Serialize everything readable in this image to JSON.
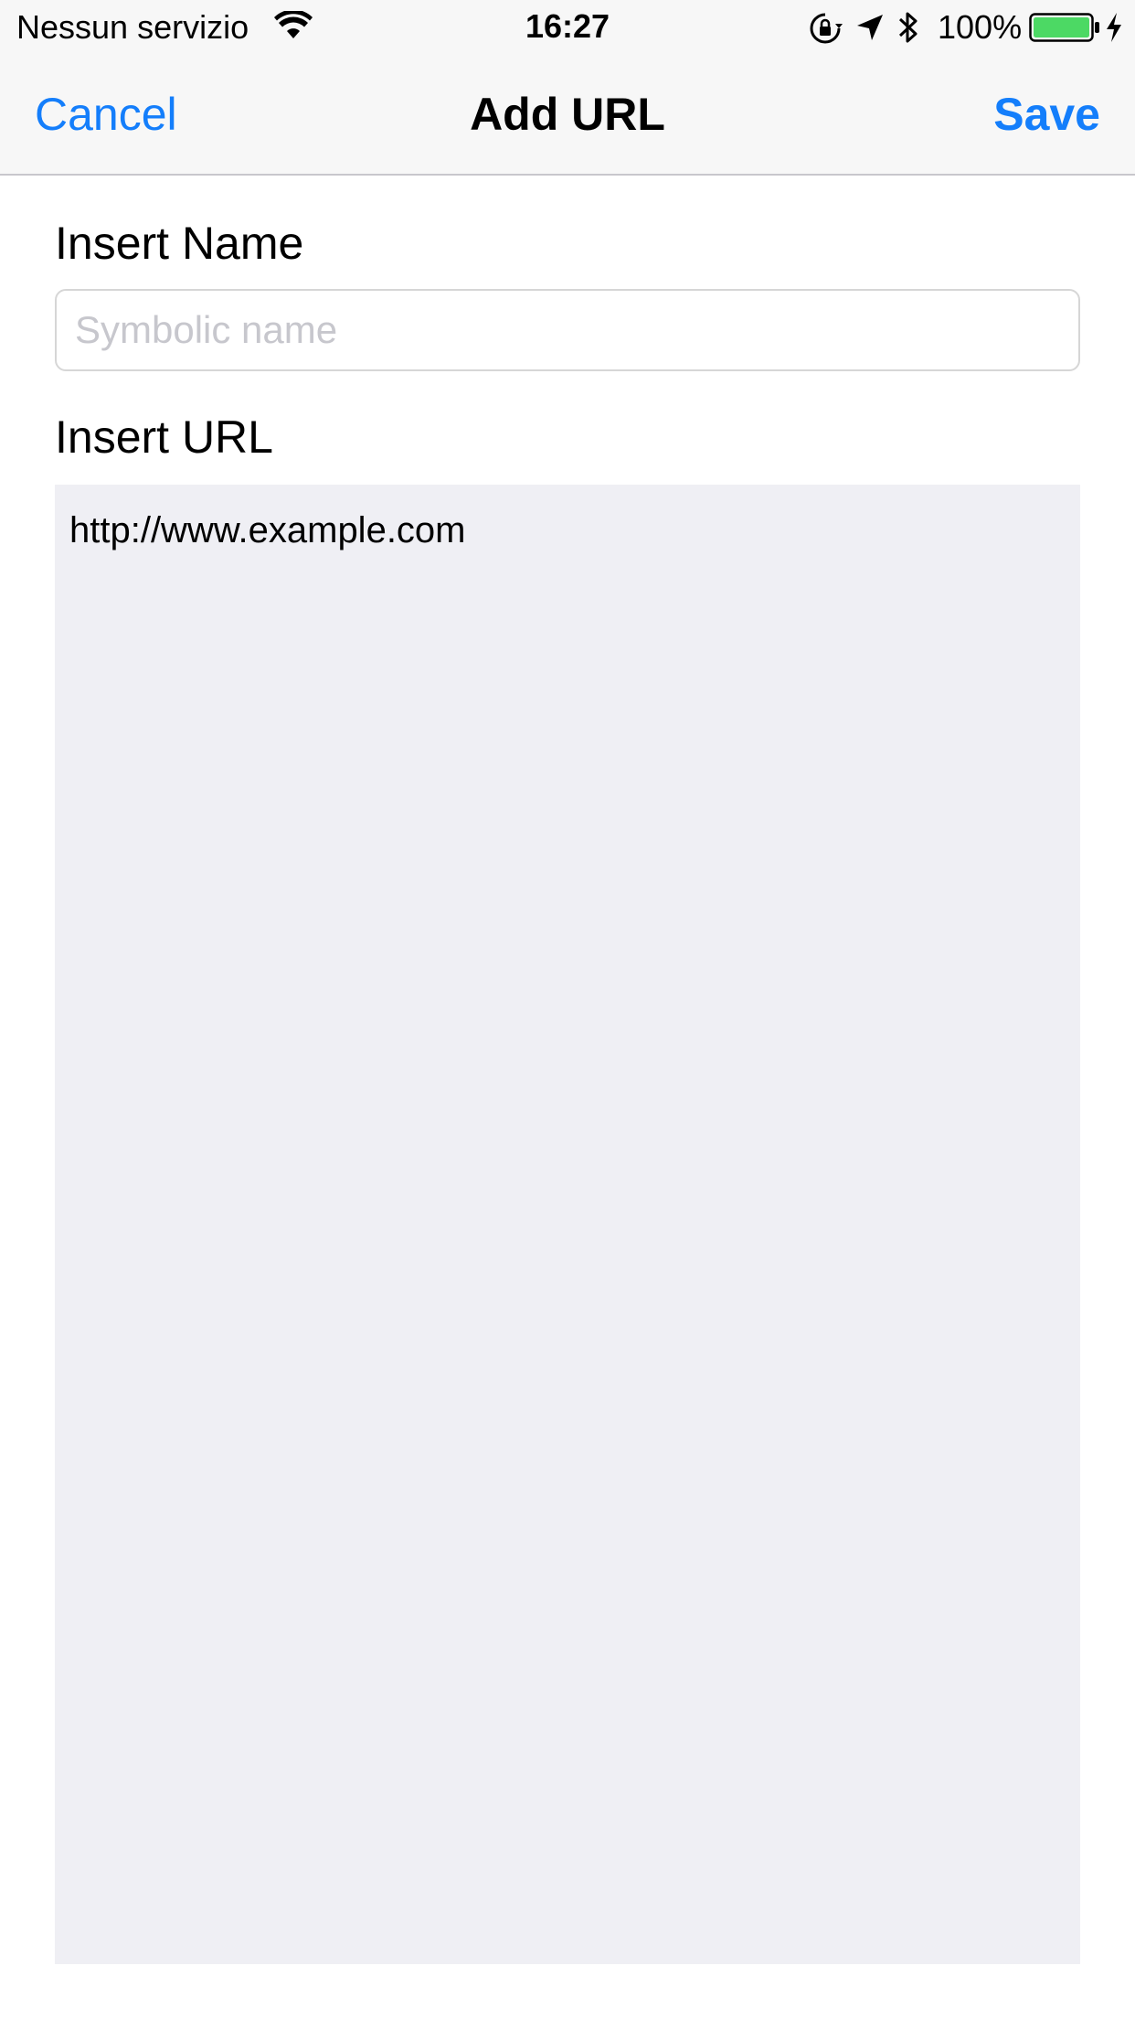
{
  "status_bar": {
    "carrier": "Nessun servizio",
    "time": "16:27",
    "battery_percent": "100%",
    "battery_level": 1.0,
    "battery_color": "#4cd964",
    "icons": [
      "wifi-icon",
      "orientation-lock-icon",
      "location-icon",
      "bluetooth-icon",
      "battery-icon",
      "charging-icon"
    ]
  },
  "nav": {
    "cancel_label": "Cancel",
    "title": "Add URL",
    "save_label": "Save",
    "accent_color": "#147efb"
  },
  "form": {
    "name_label": "Insert Name",
    "name_placeholder": "Symbolic name",
    "name_value": "",
    "url_label": "Insert URL",
    "url_value": "http://www.example.com"
  }
}
